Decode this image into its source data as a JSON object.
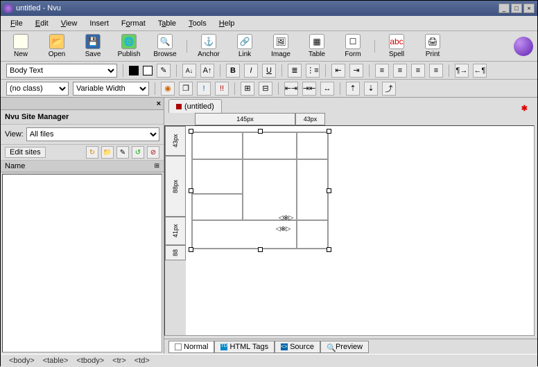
{
  "titlebar": {
    "title": "untitled - Nvu"
  },
  "menu": {
    "file": "File",
    "edit": "Edit",
    "view": "View",
    "insert": "Insert",
    "format": "Format",
    "table": "Table",
    "tools": "Tools",
    "help": "Help"
  },
  "toolbar": {
    "new": "New",
    "open": "Open",
    "save": "Save",
    "publish": "Publish",
    "browse": "Browse",
    "anchor": "Anchor",
    "link": "Link",
    "image": "Image",
    "table": "Table",
    "form": "Form",
    "spell": "Spell",
    "print": "Print"
  },
  "format": {
    "paragraph": "Body Text",
    "classsel": "(no class)",
    "fontsel": "Variable Width"
  },
  "sidebar": {
    "title": "Nvu Site Manager",
    "viewlbl": "View:",
    "viewsel": "All files",
    "editsites": "Edit sites",
    "namecol": "Name"
  },
  "doc": {
    "tab": "(untitled)"
  },
  "rulers": {
    "h1": "145px",
    "h2": "43px",
    "v1": "43px",
    "v2": "88px",
    "v3": "41px",
    "v4": "88"
  },
  "viewmodes": {
    "normal": "Normal",
    "htmltags": "HTML Tags",
    "source": "Source",
    "preview": "Preview"
  },
  "breadcrumb": [
    "<body>",
    "<table>",
    "<tbody>",
    "<tr>",
    "<td>"
  ]
}
